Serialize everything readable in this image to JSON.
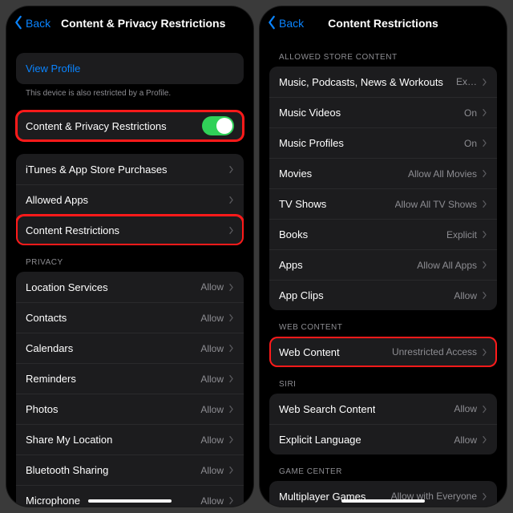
{
  "left": {
    "back": "Back",
    "title": "Content & Privacy Restrictions",
    "viewProfile": "View Profile",
    "profileCaption": "This device is also restricted by a Profile.",
    "toggleRow": {
      "label": "Content & Privacy Restrictions"
    },
    "group1": [
      {
        "label": "iTunes & App Store Purchases"
      },
      {
        "label": "Allowed Apps"
      },
      {
        "label": "Content Restrictions",
        "hl": true
      }
    ],
    "privacyHeader": "PRIVACY",
    "privacy": [
      {
        "label": "Location Services",
        "detail": "Allow"
      },
      {
        "label": "Contacts",
        "detail": "Allow"
      },
      {
        "label": "Calendars",
        "detail": "Allow"
      },
      {
        "label": "Reminders",
        "detail": "Allow"
      },
      {
        "label": "Photos",
        "detail": "Allow"
      },
      {
        "label": "Share My Location",
        "detail": "Allow"
      },
      {
        "label": "Bluetooth Sharing",
        "detail": "Allow"
      },
      {
        "label": "Microphone",
        "detail": "Allow"
      }
    ]
  },
  "right": {
    "back": "Back",
    "title": "Content Restrictions",
    "storeHeader": "ALLOWED STORE CONTENT",
    "store": [
      {
        "label": "Music, Podcasts, News & Workouts",
        "detail": "Ex…"
      },
      {
        "label": "Music Videos",
        "detail": "On"
      },
      {
        "label": "Music Profiles",
        "detail": "On"
      },
      {
        "label": "Movies",
        "detail": "Allow All Movies"
      },
      {
        "label": "TV Shows",
        "detail": "Allow All TV Shows"
      },
      {
        "label": "Books",
        "detail": "Explicit"
      },
      {
        "label": "Apps",
        "detail": "Allow All Apps"
      },
      {
        "label": "App Clips",
        "detail": "Allow"
      }
    ],
    "webHeader": "WEB CONTENT",
    "web": [
      {
        "label": "Web Content",
        "detail": "Unrestricted Access",
        "hl": true
      }
    ],
    "siriHeader": "SIRI",
    "siri": [
      {
        "label": "Web Search Content",
        "detail": "Allow"
      },
      {
        "label": "Explicit Language",
        "detail": "Allow"
      }
    ],
    "gameHeader": "GAME CENTER",
    "game": [
      {
        "label": "Multiplayer Games",
        "detail": "Allow with Everyone"
      }
    ]
  }
}
